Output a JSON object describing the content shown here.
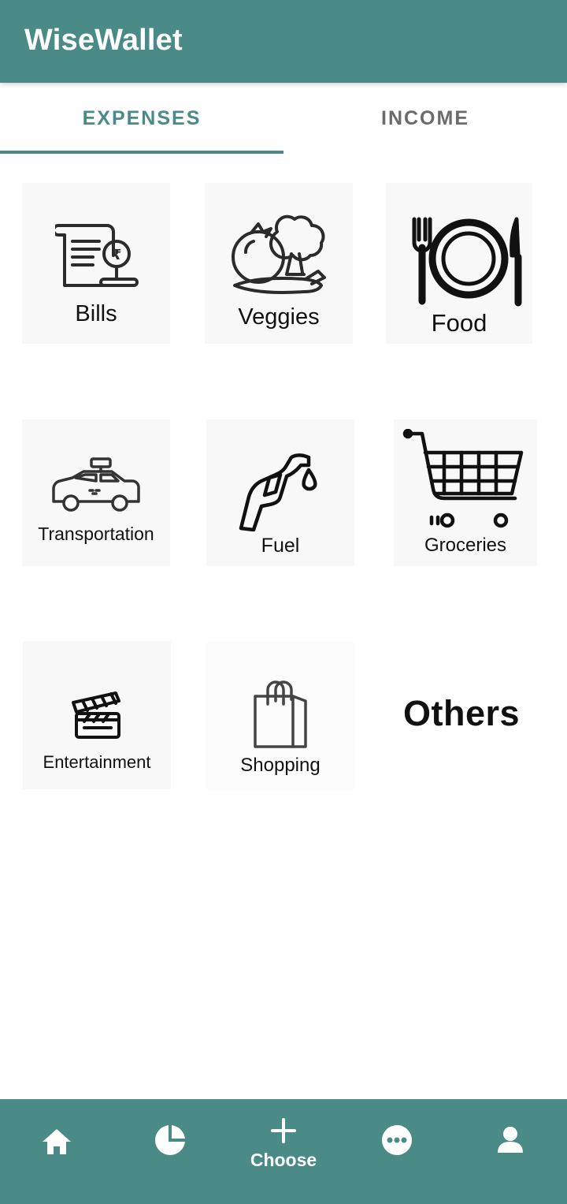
{
  "app": {
    "title": "WiseWallet"
  },
  "tabs": [
    {
      "label": "EXPENSES",
      "active": true
    },
    {
      "label": "INCOME",
      "active": false
    }
  ],
  "categories": [
    {
      "label": "Bills",
      "icon": "bill-receipt-icon"
    },
    {
      "label": "Veggies",
      "icon": "vegetables-icon"
    },
    {
      "label": "Food",
      "icon": "plate-fork-knife-icon"
    },
    {
      "label": "Transportation",
      "icon": "taxi-car-icon"
    },
    {
      "label": "Fuel",
      "icon": "fuel-nozzle-icon"
    },
    {
      "label": "Groceries",
      "icon": "shopping-cart-icon"
    },
    {
      "label": "Entertainment",
      "icon": "clapperboard-icon"
    },
    {
      "label": "Shopping",
      "icon": "shopping-bag-icon"
    },
    {
      "label": "Others",
      "icon": ""
    }
  ],
  "bottom_nav": {
    "items": [
      {
        "name": "home",
        "icon": "home-icon"
      },
      {
        "name": "stats",
        "icon": "pie-chart-icon"
      },
      {
        "name": "choose",
        "icon": "plus-icon",
        "label": "Choose"
      },
      {
        "name": "more",
        "icon": "more-horizontal-icon"
      },
      {
        "name": "profile",
        "icon": "person-icon"
      }
    ]
  },
  "colors": {
    "primary": "#4a8a87",
    "tab_inactive": "#6b6b6b",
    "tile_bg": "#f8f8f8"
  }
}
